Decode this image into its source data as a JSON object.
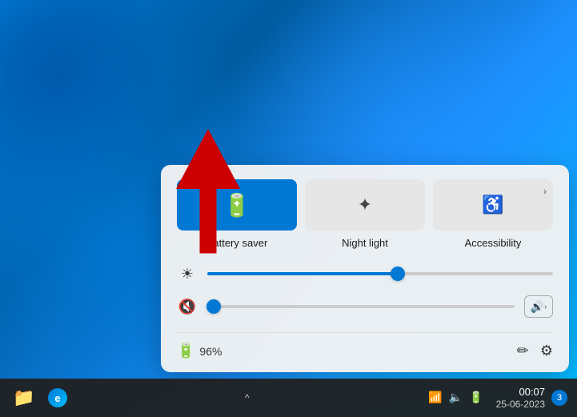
{
  "desktop": {
    "background_description": "Windows 11 blue wavy desktop"
  },
  "panel": {
    "toggles": [
      {
        "id": "battery-saver",
        "label": "Battery saver",
        "active": true,
        "icon": "🔋",
        "has_chevron": false
      },
      {
        "id": "night-light",
        "label": "Night light",
        "active": false,
        "icon": "☀",
        "has_chevron": false
      },
      {
        "id": "accessibility",
        "label": "Accessibility",
        "active": false,
        "icon": "♿",
        "has_chevron": true
      }
    ],
    "brightness": {
      "label": "Brightness",
      "icon": "☀",
      "value": 55
    },
    "volume": {
      "label": "Volume",
      "icon": "🔇",
      "value": 2,
      "muted": true
    },
    "battery": {
      "icon": "🔋",
      "percent": "96%"
    },
    "edit_icon": "✏",
    "settings_icon": "⚙"
  },
  "taskbar": {
    "apps": [
      {
        "id": "file-explorer",
        "label": "File Explorer",
        "icon": "📁"
      },
      {
        "id": "edge",
        "label": "Microsoft Edge",
        "icon": "e"
      }
    ],
    "chevron_up": "^",
    "system_icons": {
      "wifi": "📶",
      "volume": "🔈",
      "battery": "🔋"
    },
    "clock": {
      "time": "00:07",
      "date": "25-06-2023"
    },
    "notification_count": "3"
  },
  "arrow": {
    "label": "Red arrow pointing to Battery saver"
  }
}
